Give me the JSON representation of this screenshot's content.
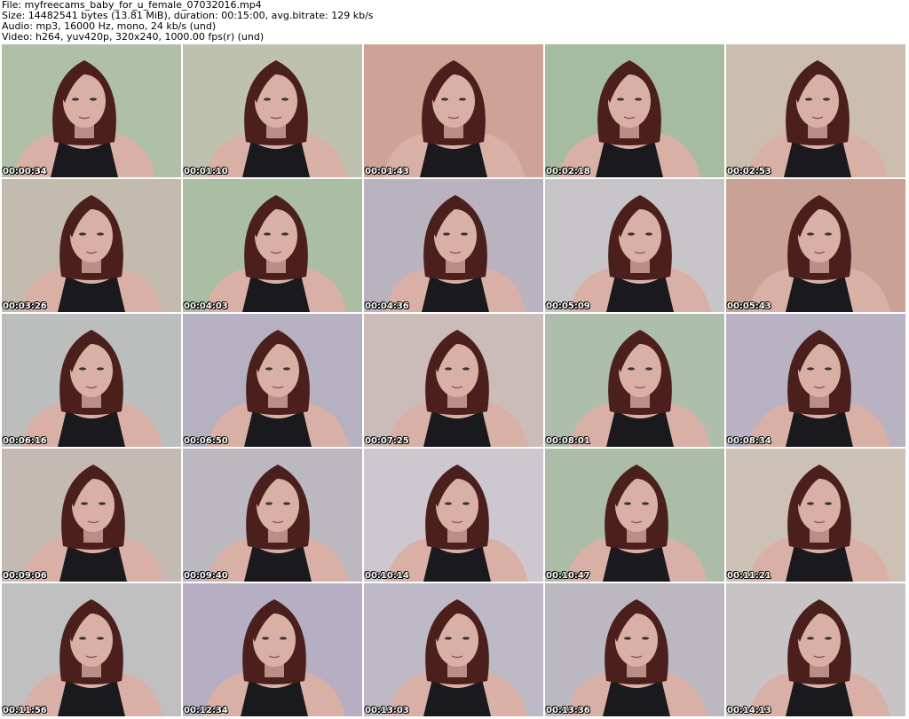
{
  "header": {
    "file_line": "File: myfreecams_baby_for_u_female_07032016.mp4",
    "size_line": "Size: 14482541 bytes (13.81 MiB), duration: 00:15:00, avg.bitrate: 129 kb/s",
    "audio_line": "Audio: mp3, 16000 Hz, mono, 24 kb/s (und)",
    "video_line": "Video: h264, yuv420p, 320x240, 1000.00 fps(r) (und)"
  },
  "thumbnails": [
    {
      "timestamp": "00:00:34",
      "bg": "#a9bba0"
    },
    {
      "timestamp": "00:01:10",
      "bg": "#b9bca6"
    },
    {
      "timestamp": "00:01:43",
      "bg": "#c99c8e"
    },
    {
      "timestamp": "00:02:18",
      "bg": "#9fb79a"
    },
    {
      "timestamp": "00:02:53",
      "bg": "#c7b9a9"
    },
    {
      "timestamp": "00:03:26",
      "bg": "#bfb6a9"
    },
    {
      "timestamp": "00:04:03",
      "bg": "#a3b99c"
    },
    {
      "timestamp": "00:04:36",
      "bg": "#b3adbb"
    },
    {
      "timestamp": "00:05:09",
      "bg": "#c4c0c4"
    },
    {
      "timestamp": "00:05:43",
      "bg": "#c69a8d"
    },
    {
      "timestamp": "00:06:16",
      "bg": "#b7b9b9"
    },
    {
      "timestamp": "00:06:50",
      "bg": "#b0abbb"
    },
    {
      "timestamp": "00:07:25",
      "bg": "#c7b7b3"
    },
    {
      "timestamp": "00:08:01",
      "bg": "#a8b9a5"
    },
    {
      "timestamp": "00:08:34",
      "bg": "#b3acbd"
    },
    {
      "timestamp": "00:09:06",
      "bg": "#c0b4ad"
    },
    {
      "timestamp": "00:09:40",
      "bg": "#b7b2ba"
    },
    {
      "timestamp": "00:10:14",
      "bg": "#c9c4cc"
    },
    {
      "timestamp": "00:10:47",
      "bg": "#a5b8a0"
    },
    {
      "timestamp": "00:11:21",
      "bg": "#c8bcae"
    },
    {
      "timestamp": "00:11:56",
      "bg": "#bbbbbb"
    },
    {
      "timestamp": "00:12:34",
      "bg": "#b0a9bf"
    },
    {
      "timestamp": "00:13:03",
      "bg": "#b8b3c2"
    },
    {
      "timestamp": "00:13:36",
      "bg": "#b6b2bd"
    },
    {
      "timestamp": "00:14:13",
      "bg": "#c4bfc0"
    }
  ],
  "colors": {
    "hair": "#4a1f1c",
    "skin": "#d9b0a6",
    "top": "#1a1a1e",
    "shadow": "#b88e86"
  }
}
